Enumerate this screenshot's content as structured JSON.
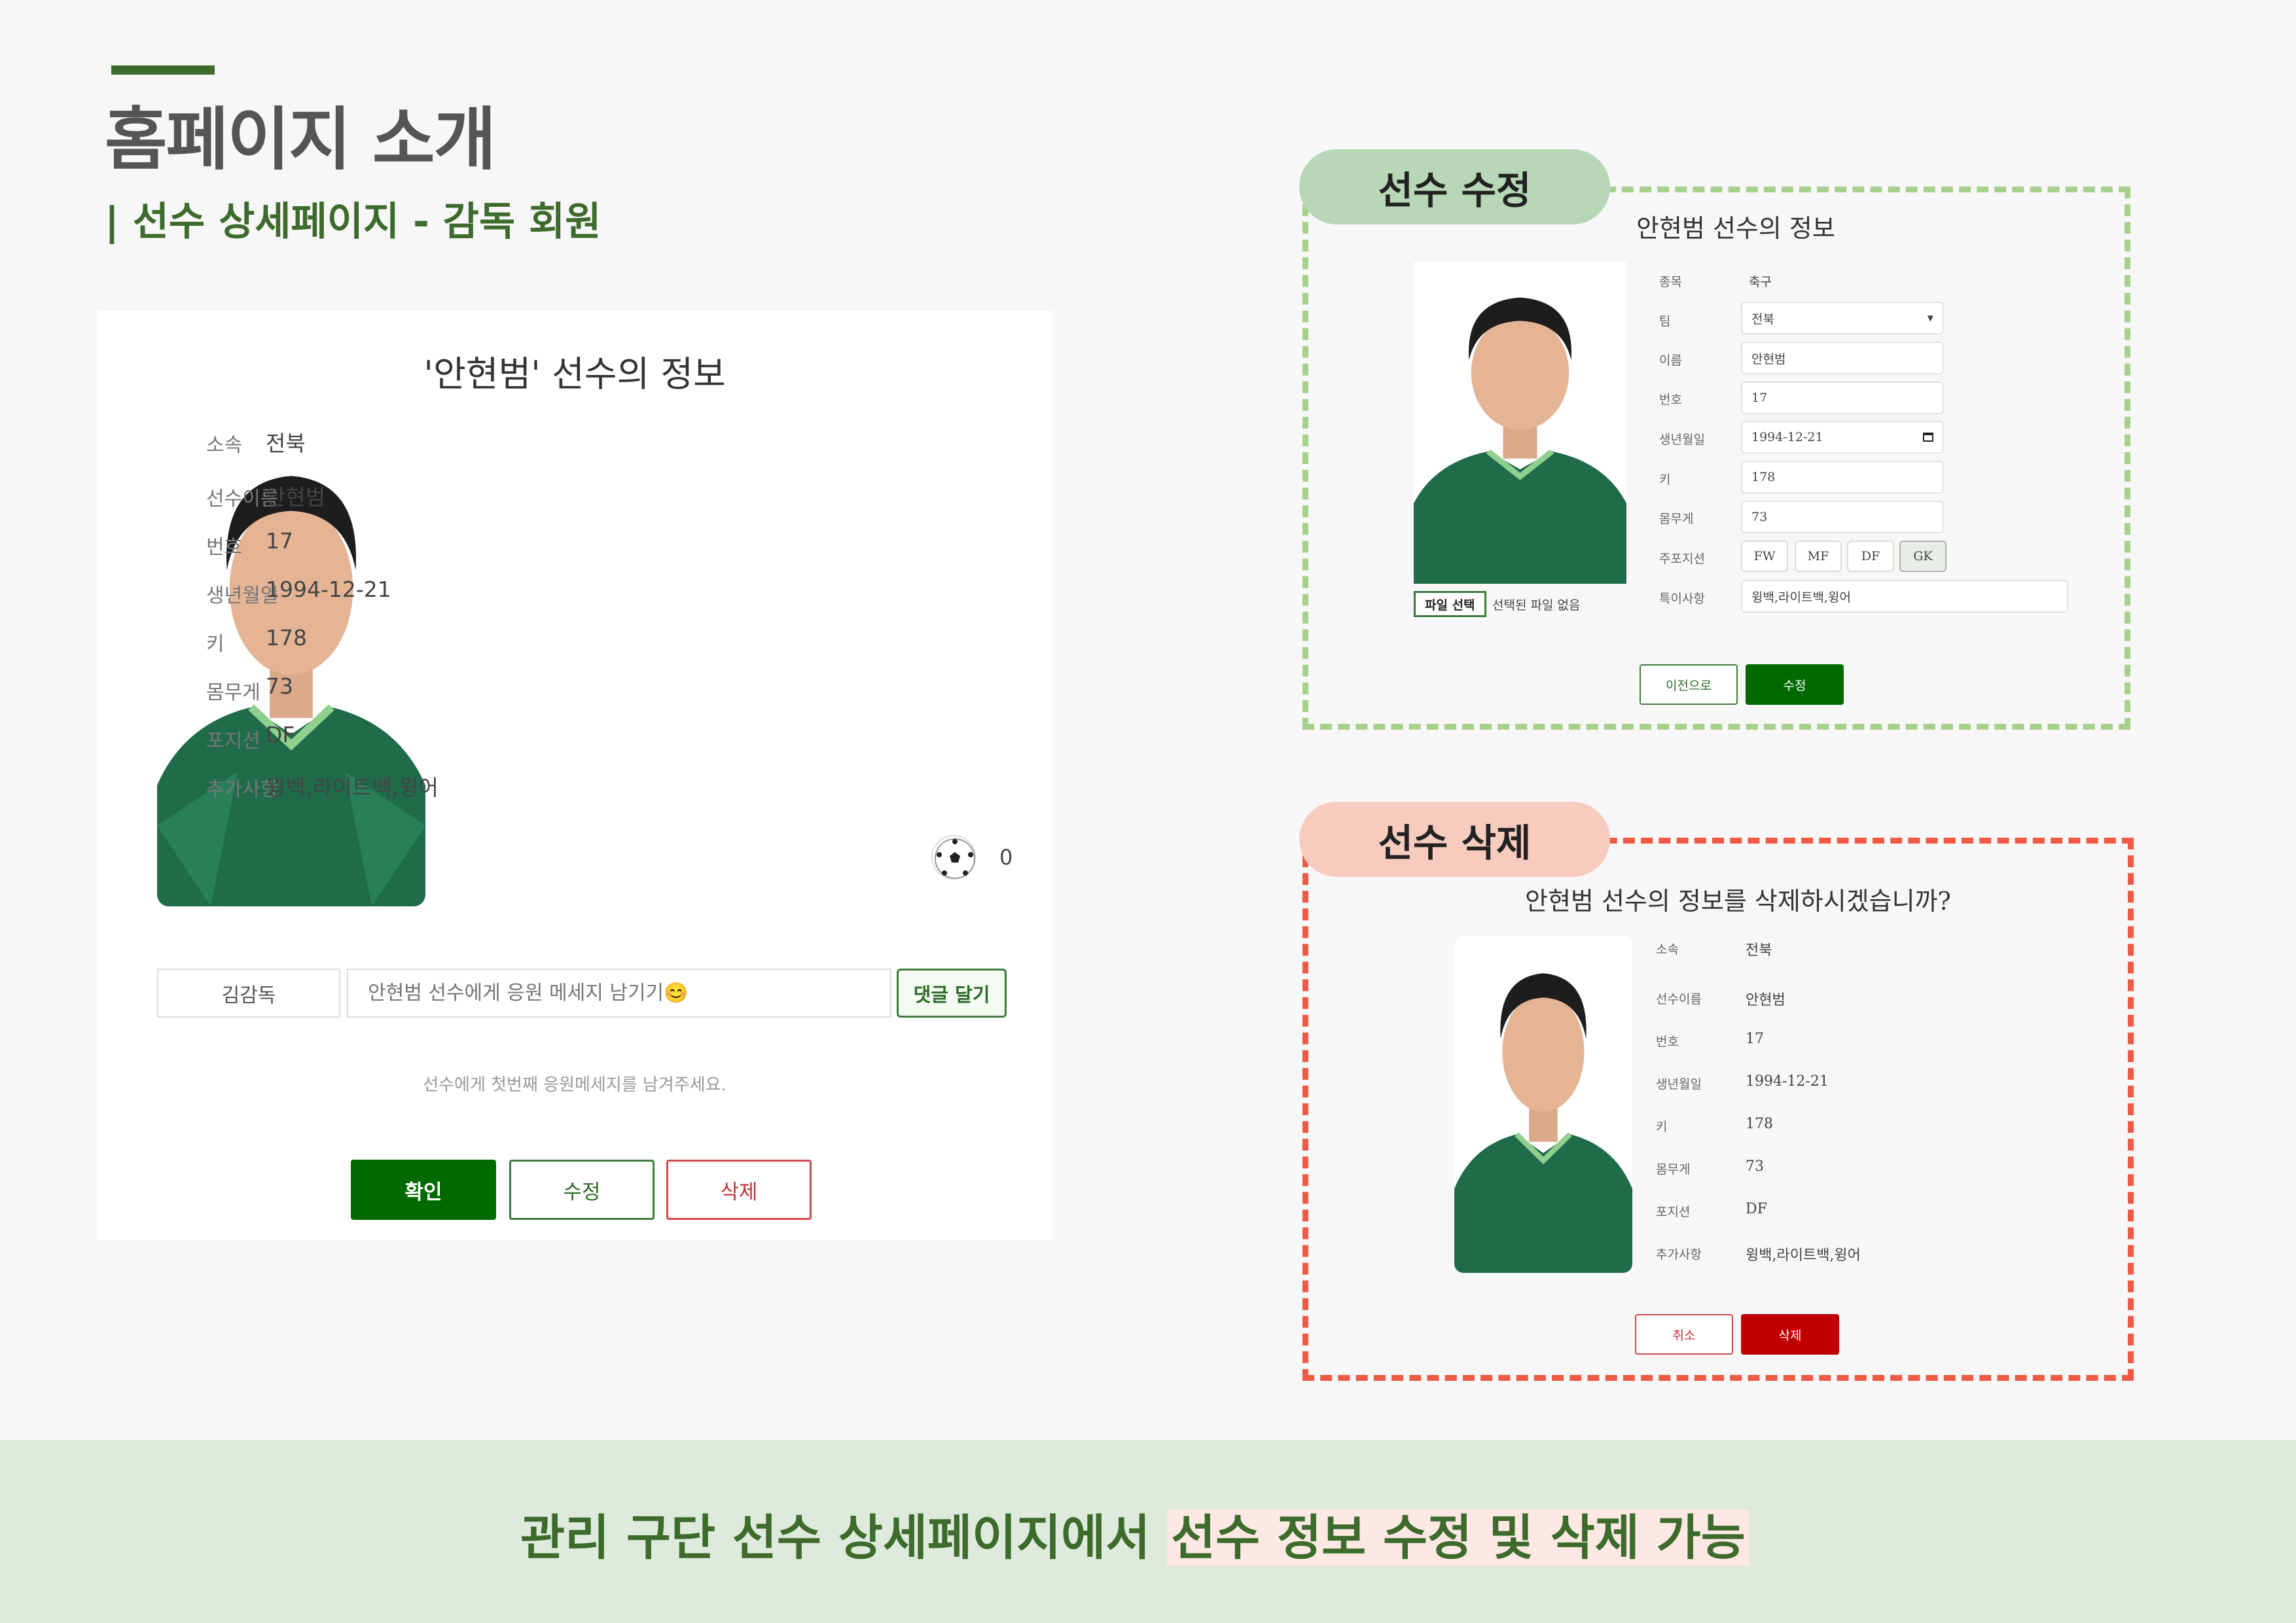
{
  "header": {
    "title": "홈페이지 소개",
    "subtitle": "| 선수 상세페이지 - 감독 회원"
  },
  "detail": {
    "title": "'안현범' 선수의 정보",
    "labels": [
      "소속",
      "선수이름",
      "번호",
      "생년월일",
      "키",
      "몸무게",
      "포지션",
      "추가사항"
    ],
    "values": [
      "전북",
      "안현범",
      "17",
      "1994-12-21",
      "178",
      "73",
      "DF",
      "윙백,라이트백,윙어"
    ],
    "like_count": "0",
    "comment_author": "김감독",
    "comment_placeholder": "안현범 선수에게 응원 메세지 남기기😊",
    "comment_submit": "댓글 달기",
    "empty_message": "선수에게 첫번째 응원메세지를 남겨주세요.",
    "buttons": {
      "confirm": "확인",
      "edit": "수정",
      "delete": "삭제"
    }
  },
  "edit": {
    "tag": "선수 수정",
    "heading": "안현범 선수의 정보",
    "labels": [
      "종목",
      "팀",
      "이름",
      "번호",
      "생년월일",
      "키",
      "몸무게",
      "주포지션",
      "특이사항"
    ],
    "sport": "축구",
    "team": "전북",
    "name": "안현범",
    "number": "17",
    "birth": "1994-12-21",
    "height": "178",
    "weight": "73",
    "positions": [
      "FW",
      "MF",
      "DF",
      "GK"
    ],
    "selected_position": "GK",
    "notes": "윙백,라이트백,윙어",
    "file_button": "파일 선택",
    "file_status": "선택된 파일 없음",
    "back_button": "이전으로",
    "submit_button": "수정"
  },
  "delete": {
    "tag": "선수 삭제",
    "heading": "안현범 선수의 정보를 삭제하시겠습니까?",
    "labels": [
      "소속",
      "선수이름",
      "번호",
      "생년월일",
      "키",
      "몸무게",
      "포지션",
      "추가사항"
    ],
    "values": [
      "전북",
      "안현범",
      "17",
      "1994-12-21",
      "178",
      "73",
      "DF",
      "윙백,라이트백,윙어"
    ],
    "cancel_button": "취소",
    "delete_button": "삭제"
  },
  "banner": {
    "text_plain": "관리 구단 선수 상세페이지에서 ",
    "text_highlight": "선수 정보 수정 및 삭제 가능"
  },
  "colors": {
    "brand_green": "#3d6b2c",
    "confirm_green": "#006a00",
    "delete_red": "#c00000",
    "edit_border": "#a8d08d",
    "delete_border": "#ee5a44"
  }
}
